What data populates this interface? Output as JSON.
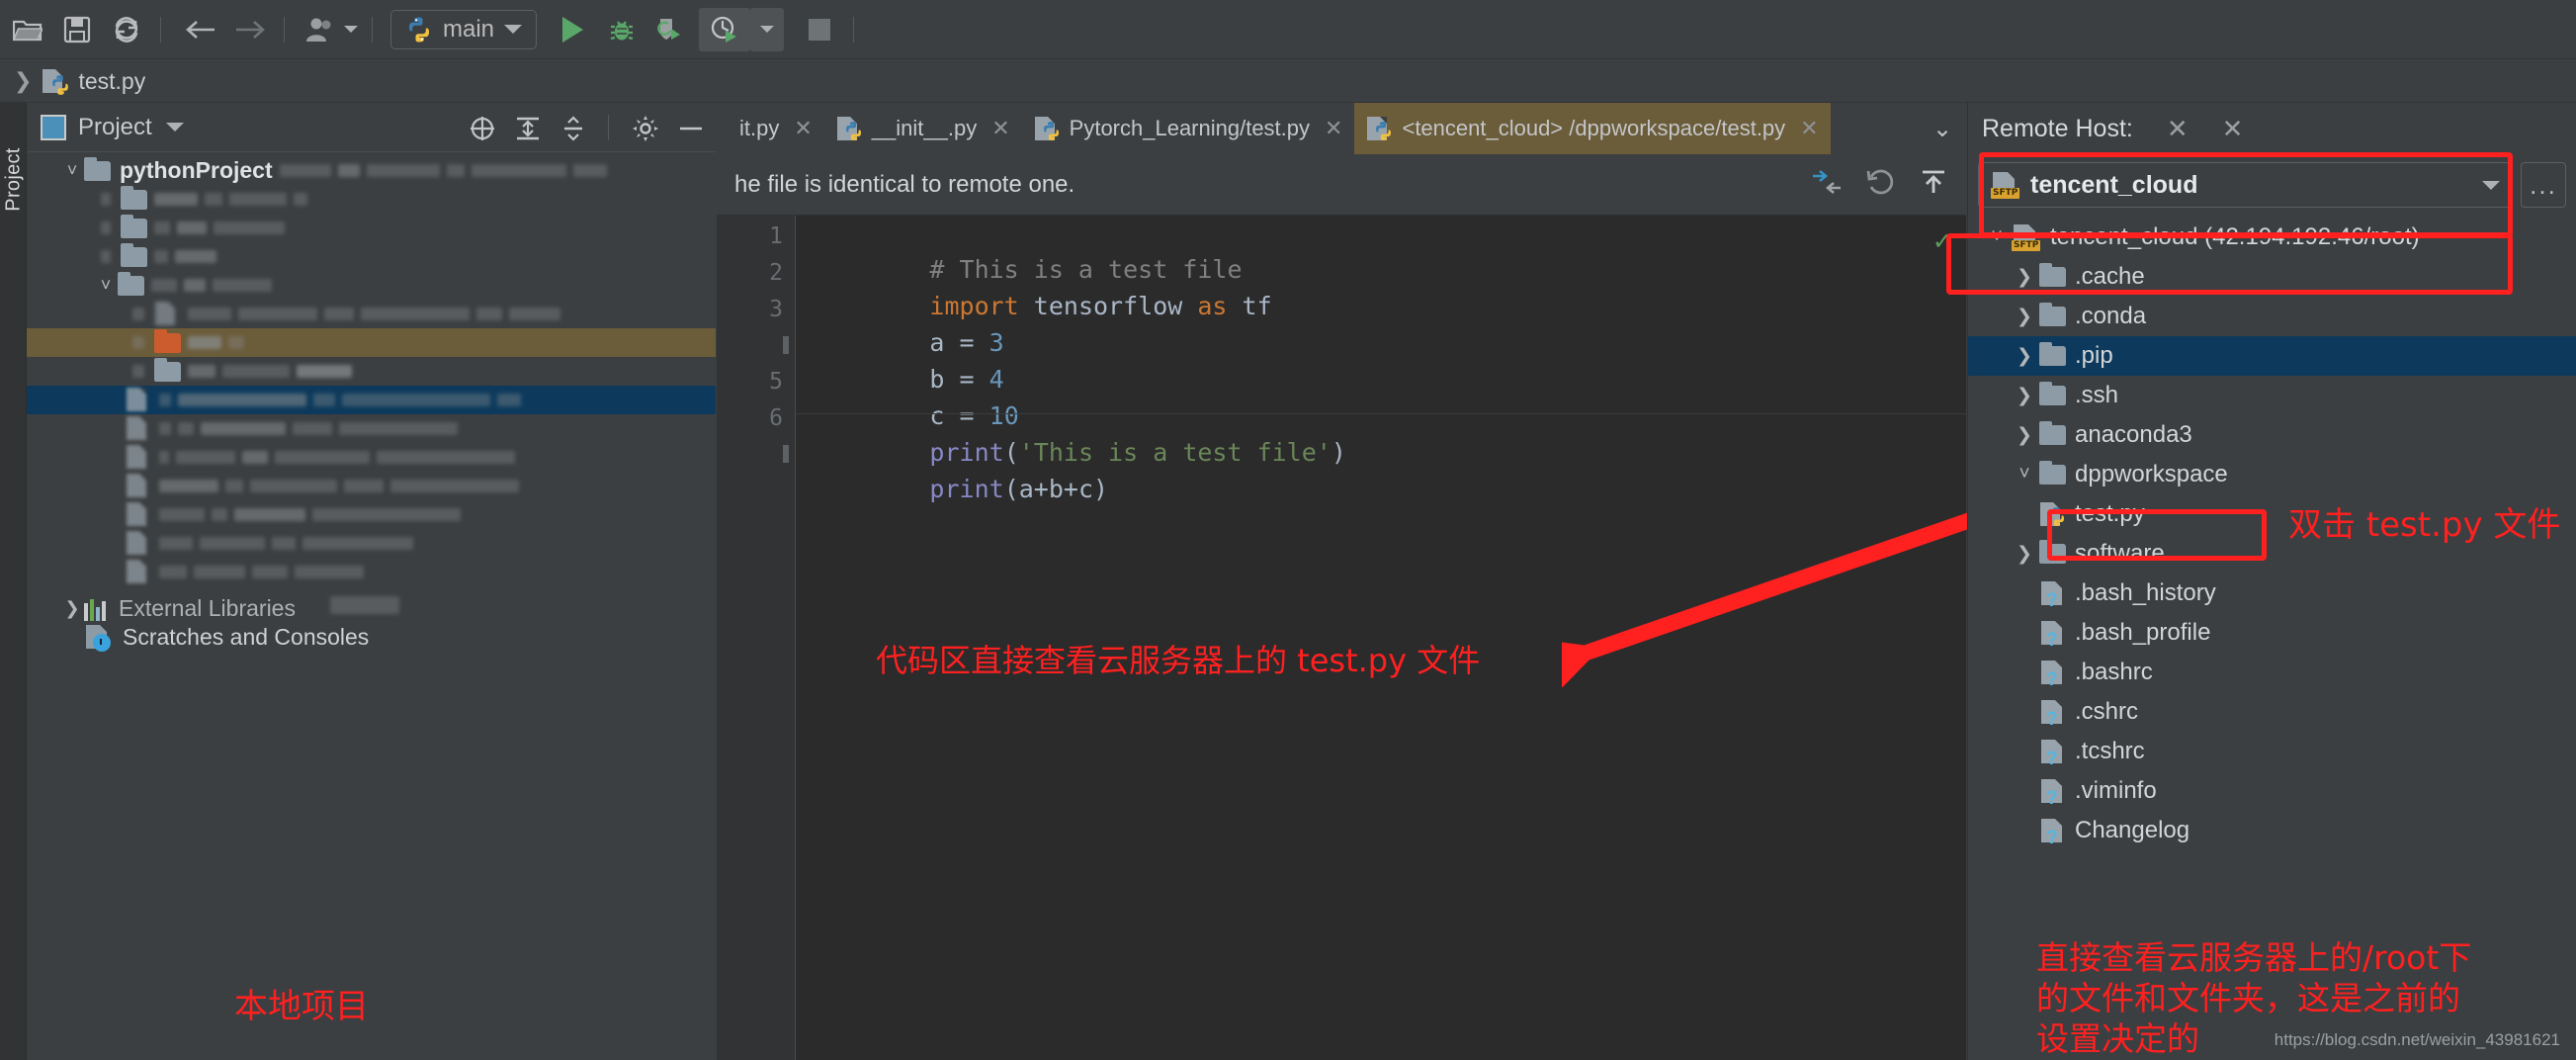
{
  "toolbar": {
    "buttons": [
      {
        "name": "open-folder-icon",
        "label": "Open"
      },
      {
        "name": "save-icon",
        "label": "Save All"
      },
      {
        "name": "sync-icon",
        "label": "Synchronize"
      },
      {
        "name": "back-arrow-icon",
        "label": "Back"
      },
      {
        "name": "forward-arrow-icon",
        "label": "Forward"
      },
      {
        "name": "vcs-user-icon",
        "label": "Update Project"
      }
    ],
    "run_config": {
      "label": "main",
      "icon": "python-icon"
    },
    "run_label": "Run",
    "debug_label": "Debug",
    "coverage_label": "Run with Coverage",
    "profile_label": "Profile",
    "stop_label": "Stop"
  },
  "breadcrumb": {
    "items": [
      "test.py"
    ]
  },
  "left_strip": {
    "label": "Project"
  },
  "project_panel": {
    "title": "Project",
    "actions": [
      "locate-icon",
      "expand-all-icon",
      "collapse-all-icon",
      "settings-gear-icon",
      "hide-icon"
    ],
    "root": "pythonProject",
    "external_libraries": "External Libraries",
    "scratches": "Scratches and Consoles",
    "annotation": "本地项目"
  },
  "editor": {
    "tabs": [
      {
        "label": "it.py",
        "active": false,
        "icon": "python-file-icon"
      },
      {
        "label": "__init__.py",
        "active": false,
        "icon": "python-file-icon"
      },
      {
        "label": "Pytorch_Learning/test.py",
        "active": false,
        "icon": "python-file-icon"
      },
      {
        "label": "<tencent_cloud> /dppworkspace/test.py",
        "active": true,
        "icon": "python-file-icon"
      }
    ],
    "tabs_overflow_icon": "chevron-down-icon",
    "notification": "he file is identical to remote one.",
    "notification_actions": [
      "diff-icon",
      "revert-icon",
      "upload-icon"
    ],
    "line_numbers": [
      "1",
      "2",
      "3",
      "",
      "5",
      "6",
      ""
    ],
    "code_lines": [
      [
        {
          "t": "# This is a test file",
          "c": "com"
        }
      ],
      [
        {
          "t": "import",
          "c": "kw"
        },
        {
          "t": " tensorflow ",
          "c": "id"
        },
        {
          "t": "as",
          "c": "kw"
        },
        {
          "t": " tf",
          "c": "id"
        }
      ],
      [
        {
          "t": "a = ",
          "c": "id"
        },
        {
          "t": "3",
          "c": "num"
        }
      ],
      [
        {
          "t": "b = ",
          "c": "id"
        },
        {
          "t": "4",
          "c": "num"
        }
      ],
      [
        {
          "t": "c = ",
          "c": "id"
        },
        {
          "t": "10",
          "c": "num"
        }
      ],
      [
        {
          "t": "print",
          "c": "fn"
        },
        {
          "t": "(",
          "c": "id"
        },
        {
          "t": "'This is a test file'",
          "c": "str"
        },
        {
          "t": ")",
          "c": "id"
        }
      ],
      [
        {
          "t": "print",
          "c": "fn"
        },
        {
          "t": "(a+b+c)",
          "c": "id"
        }
      ]
    ],
    "annotation": "代码区直接查看云服务器上的 test.py 文件",
    "inspection_status": "✓"
  },
  "remote_host": {
    "title": "Remote Host:",
    "close_icons": [
      "close-icon",
      "close-icon"
    ],
    "connection": {
      "value": "tencent_cloud",
      "icon": "sftp-icon"
    },
    "more_button": "...",
    "tree": [
      {
        "label": "tencent_cloud (42.194.192.46/root)",
        "indent": 0,
        "arrow": "v",
        "icon": "sftp-icon",
        "selected": false
      },
      {
        "label": ".cache",
        "indent": 1,
        "arrow": ">",
        "icon": "folder-icon",
        "selected": false
      },
      {
        "label": ".conda",
        "indent": 1,
        "arrow": ">",
        "icon": "folder-icon",
        "selected": false
      },
      {
        "label": ".pip",
        "indent": 1,
        "arrow": ">",
        "icon": "folder-icon",
        "selected": true
      },
      {
        "label": ".ssh",
        "indent": 1,
        "arrow": ">",
        "icon": "folder-icon",
        "selected": false
      },
      {
        "label": "anaconda3",
        "indent": 1,
        "arrow": ">",
        "icon": "folder-icon",
        "selected": false
      },
      {
        "label": "dppworkspace",
        "indent": 1,
        "arrow": "v",
        "icon": "folder-icon",
        "selected": false
      },
      {
        "label": "test.py",
        "indent": 2,
        "arrow": "",
        "icon": "python-file-icon",
        "selected": false
      },
      {
        "label": "software",
        "indent": 1,
        "arrow": ">",
        "icon": "folder-icon",
        "selected": false
      },
      {
        "label": ".bash_history",
        "indent": 1,
        "arrow": "",
        "icon": "file-question-icon",
        "selected": false
      },
      {
        "label": ".bash_profile",
        "indent": 1,
        "arrow": "",
        "icon": "file-question-icon",
        "selected": false
      },
      {
        "label": ".bashrc",
        "indent": 1,
        "arrow": "",
        "icon": "file-question-icon",
        "selected": false
      },
      {
        "label": ".cshrc",
        "indent": 1,
        "arrow": "",
        "icon": "file-question-icon",
        "selected": false
      },
      {
        "label": ".tcshrc",
        "indent": 1,
        "arrow": "",
        "icon": "file-question-icon",
        "selected": false
      },
      {
        "label": ".viminfo",
        "indent": 1,
        "arrow": "",
        "icon": "file-question-icon",
        "selected": false
      },
      {
        "label": "Changelog",
        "indent": 1,
        "arrow": "",
        "icon": "file-question-icon",
        "selected": false
      }
    ],
    "annotation_testpy": "双击 test.py 文件",
    "annotation_bottom": "直接查看云服务器上的/root下\n的文件和文件夹，这是之前的\n设置决定的"
  },
  "watermark": "https://blog.csdn.net/weixin_43981621",
  "colors": {
    "accent_red": "#ff2020",
    "panel_bg": "#3c3f41",
    "editor_bg": "#2b2b2b",
    "selection_blue": "#0d3a5c",
    "tab_active": "#6b5c3a",
    "run_green": "#59a869"
  }
}
